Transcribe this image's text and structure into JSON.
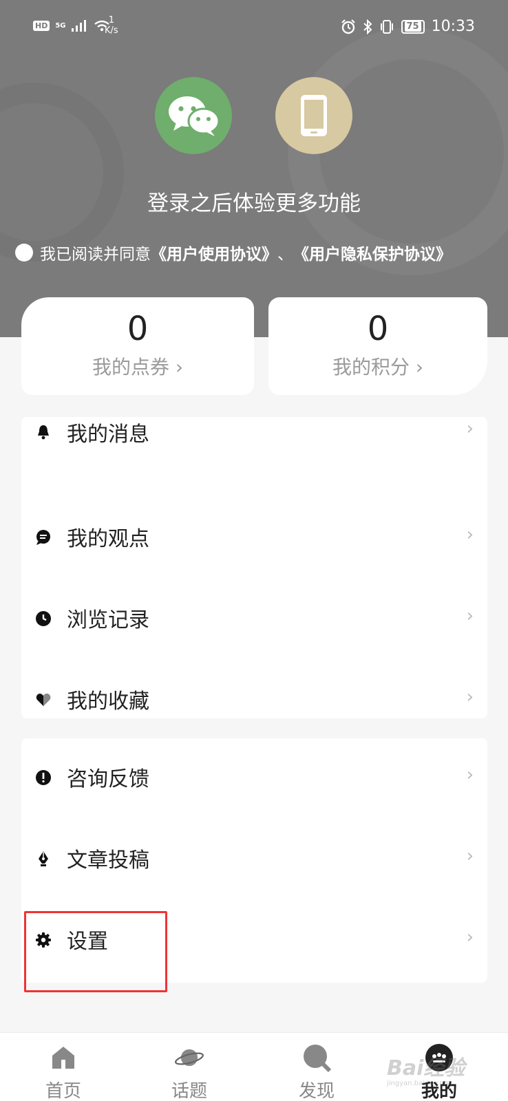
{
  "status": {
    "left_badge": "HD",
    "network": "5G",
    "speed_value": "1",
    "speed_unit": "K/s",
    "battery": "75",
    "time": "10:33"
  },
  "login": {
    "tip": "登录之后体验更多功能",
    "agree_prefix": "我已阅读并同意",
    "agree_terms": "《用户使用协议》",
    "agree_sep": "、",
    "agree_privacy": "《用户隐私保护协议》"
  },
  "cards": {
    "coupon_value": "0",
    "coupon_label": "我的点券",
    "points_value": "0",
    "points_label": "我的积分",
    "arrow": "›"
  },
  "list1": [
    {
      "label": "我的消息",
      "icon": "bell-icon"
    },
    {
      "label": "我的观点",
      "icon": "comment-icon"
    },
    {
      "label": "浏览记录",
      "icon": "clock-icon"
    },
    {
      "label": "我的收藏",
      "icon": "heart-icon"
    }
  ],
  "list2": [
    {
      "label": "咨询反馈",
      "icon": "exclamation-icon"
    },
    {
      "label": "文章投稿",
      "icon": "pen-icon"
    },
    {
      "label": "设置",
      "icon": "gear-icon"
    }
  ],
  "arrow": "›",
  "tabs": [
    {
      "label": "首页",
      "icon": "home-icon"
    },
    {
      "label": "话题",
      "icon": "planet-icon"
    },
    {
      "label": "发现",
      "icon": "search-icon"
    },
    {
      "label": "我的",
      "icon": "profile-icon"
    }
  ],
  "watermark": {
    "brand": "Bai经验",
    "url": "jingyan.baidu.com"
  },
  "colors": {
    "header_bg": "#7b7b7b",
    "wechat": "#6fae6c",
    "phone": "#d7c9a2",
    "highlight": "#e33333"
  }
}
